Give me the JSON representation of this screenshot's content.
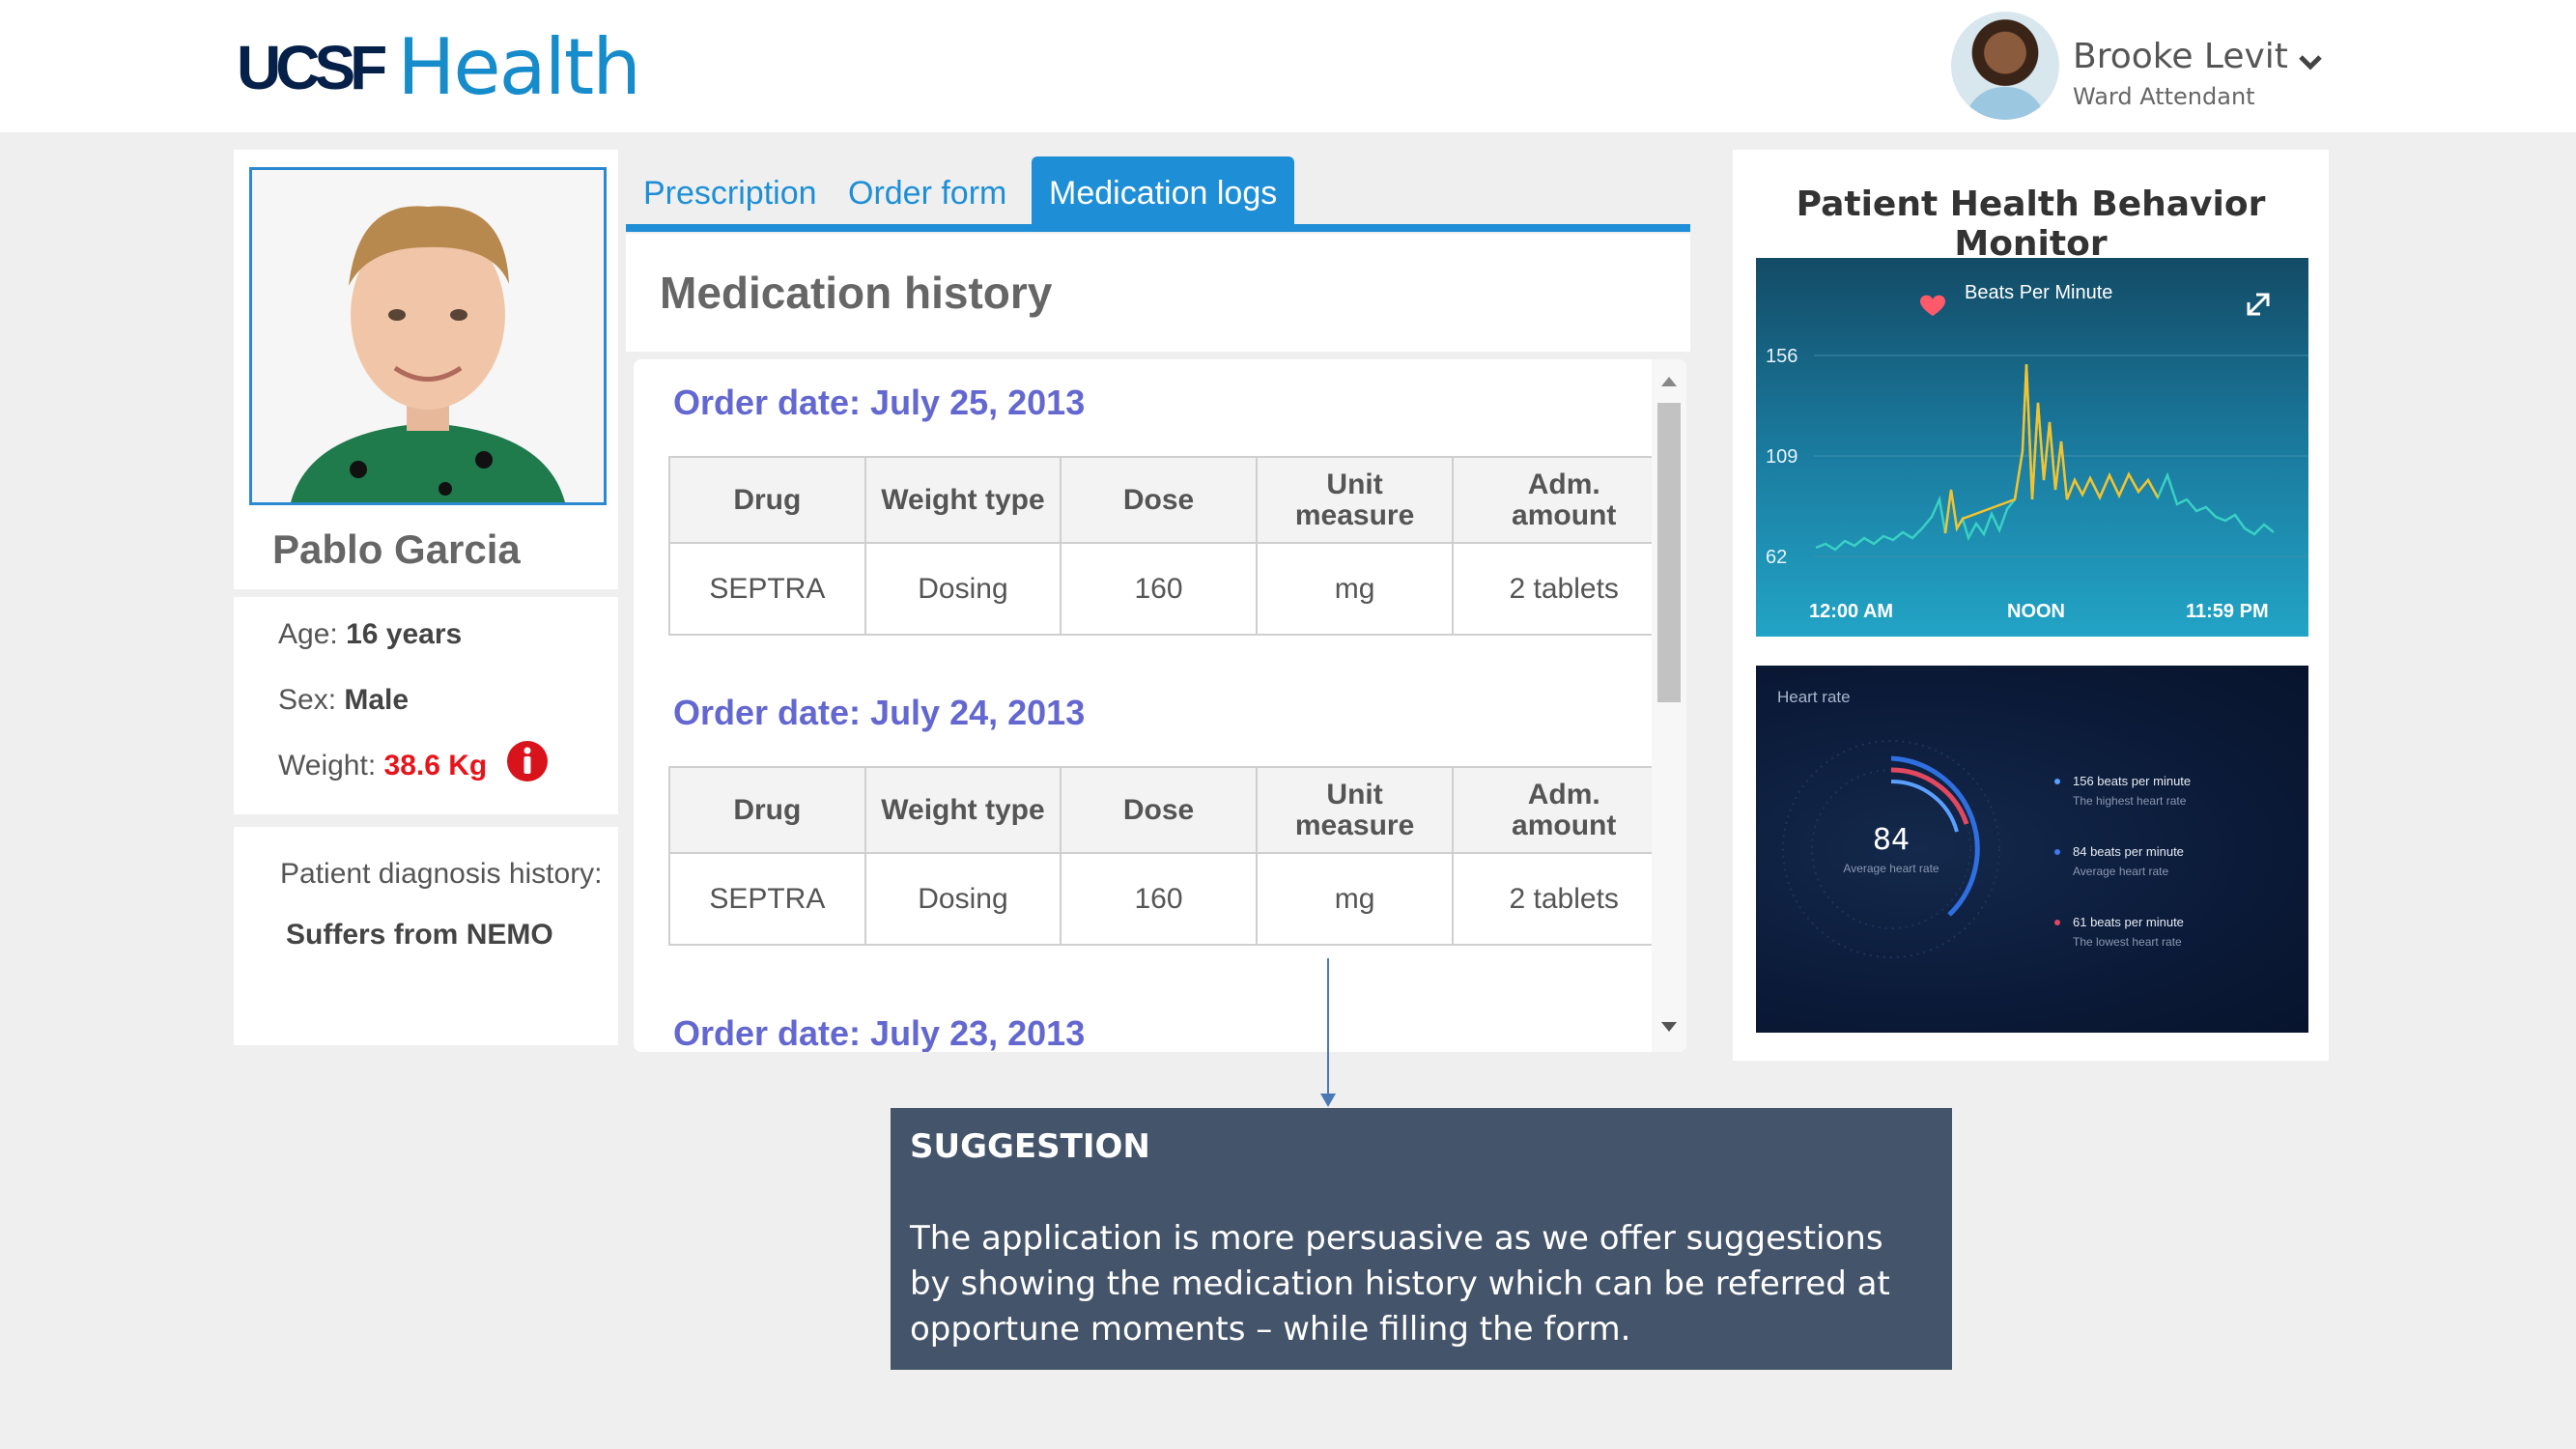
{
  "header": {
    "logo_ucsf": "UCSF",
    "logo_health": "Health",
    "user": {
      "name": "Brooke Levit",
      "role": "Ward Attendant"
    }
  },
  "patient": {
    "name": "Pablo Garcia",
    "age_label": "Age:",
    "age_value": "16 years",
    "sex_label": "Sex:",
    "sex_value": "Male",
    "weight_label": "Weight:",
    "weight_value": "38.6 Kg",
    "diagnosis_label": "Patient diagnosis history:",
    "diagnosis_value": "Suffers from NEMO"
  },
  "tabs": [
    {
      "label": "Prescription",
      "active": false
    },
    {
      "label": "Order form",
      "active": false
    },
    {
      "label": "Medication logs",
      "active": true
    }
  ],
  "history": {
    "title": "Medication history",
    "columns": [
      "Drug",
      "Weight type",
      "Dose",
      "Unit measure",
      "Adm. amount"
    ],
    "column_lines": [
      [
        "Drug"
      ],
      [
        "Weight type"
      ],
      [
        "Dose"
      ],
      [
        "Unit",
        "measure"
      ],
      [
        "Adm.",
        "amount"
      ]
    ],
    "orders": [
      {
        "date": "Order date: July 25, 2013",
        "rows": [
          [
            "SEPTRA",
            "Dosing",
            "160",
            "mg",
            "2 tablets"
          ]
        ]
      },
      {
        "date": "Order date: July 24, 2013",
        "rows": [
          [
            "SEPTRA",
            "Dosing",
            "160",
            "mg",
            "2 tablets"
          ]
        ]
      },
      {
        "date": "Order date: July 23, 2013",
        "rows": []
      }
    ]
  },
  "monitor": {
    "title": "Patient Health Behavior Monitor",
    "bpm_chart": {
      "title": "Beats Per Minute",
      "y_ticks": [
        "156",
        "109",
        "62"
      ],
      "x_ticks": [
        "12:00 AM",
        "NOON",
        "11:59 PM"
      ]
    },
    "heart_rate": {
      "title": "Heart rate",
      "average_value": "84",
      "average_label": "Average heart rate",
      "legend": [
        {
          "value": "156 beats per minute",
          "desc": "The highest heart rate",
          "color": "#5aa0ff"
        },
        {
          "value": "84 beats per minute",
          "desc": "Average heart rate",
          "color": "#3f7be8"
        },
        {
          "value": "61 beats per minute",
          "desc": "The lowest heart rate",
          "color": "#e2485f"
        }
      ]
    }
  },
  "suggestion": {
    "title": "SUGGESTION",
    "body": "The application is more persuasive as we offer suggestions by showing the medication history which can be referred at opportune moments – while filling the form."
  },
  "colors": {
    "brand_navy": "#052049",
    "brand_blue": "#178ccb",
    "tab_blue": "#1e8fd6",
    "order_date": "#6367d0",
    "alert_red": "#e8141b",
    "suggestion_bg": "#44546a"
  }
}
